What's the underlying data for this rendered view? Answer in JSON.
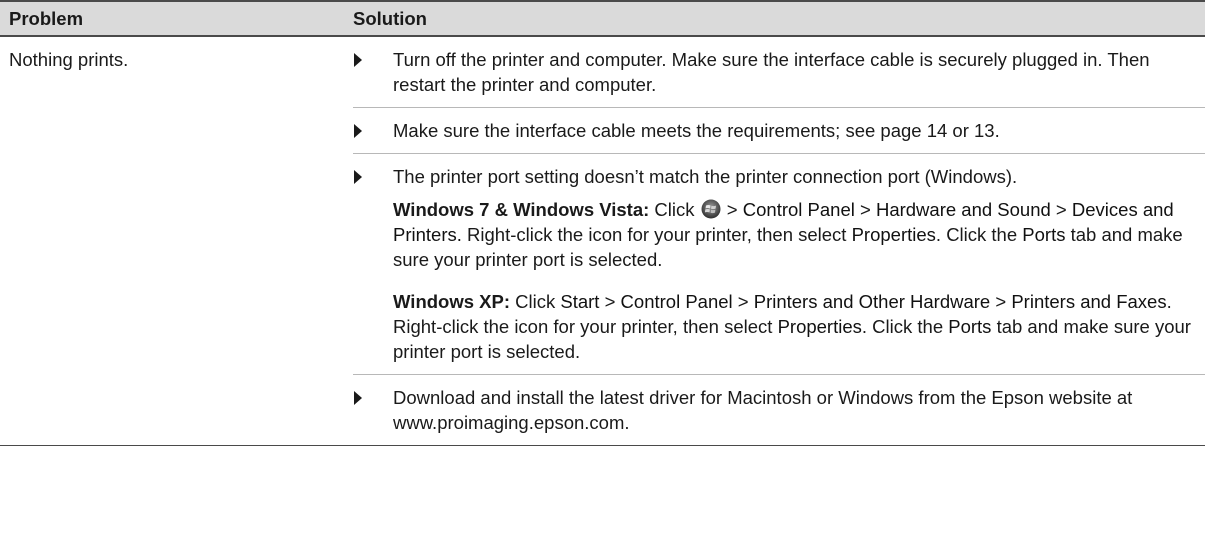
{
  "header": {
    "problem": "Problem",
    "solution": "Solution"
  },
  "problem": "Nothing prints.",
  "item1": "Turn off the printer and computer. Make sure the interface cable is securely plugged in. Then restart the printer and computer.",
  "item2": "Make sure the interface cable meets the requirements; see page 14 or 13.",
  "item3": {
    "lead": "The printer port setting doesn’t match the printer connection port (Windows).",
    "win7_label": "Windows 7 & Windows Vista:",
    "win7_t1": " Click ",
    "win7_t2": " > ",
    "win7_control_panel": "Control Panel",
    "win7_t3": " > ",
    "win7_hardware_sound": "Hardware and Sound",
    "win7_t4": " > ",
    "win7_devices_printers": "Devices and Printers.",
    "win7_t5": " Right-click the icon for your printer, then select ",
    "win7_properties": "Properties",
    "win7_t6": ". Click the ",
    "win7_ports": "Ports",
    "win7_t7": " tab and make sure your printer port is selected.",
    "xp_label": "Windows XP:",
    "xp_t1": " Click ",
    "xp_start": "Start",
    "xp_t2": " > ",
    "xp_control_panel": "Control Panel",
    "xp_t3": " > ",
    "xp_printers_hw": "Printers and Other Hardware",
    "xp_t4": " > ",
    "xp_printers_faxes": "Printers and Faxes",
    "xp_t5": ". Right-click the icon for your printer, then select ",
    "xp_properties": "Properties",
    "xp_t6": ". Click the ",
    "xp_ports": "Ports",
    "xp_t7": " tab and make sure your printer port is selected."
  },
  "item4": "Download and install the latest driver for Macintosh or Windows from the Epson website at www.proimaging.epson.com.",
  "colors": {
    "header_bg": "#dadada",
    "rule": "#4a4a4a",
    "text": "#1a1a1a"
  },
  "icons": {
    "bullet": "triangle-bullet-icon",
    "start": "windows-start-orb-icon"
  }
}
